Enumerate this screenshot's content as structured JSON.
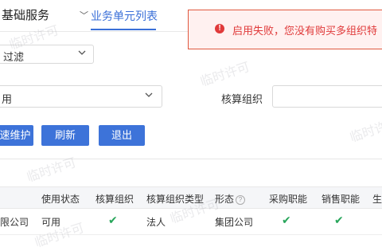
{
  "header": {
    "app_title": "基础服务",
    "active_tab": "业务单元列表"
  },
  "toast": {
    "type": "error",
    "message": "启用失败，您没有购买多组织特"
  },
  "filter": {
    "value": "过滤"
  },
  "search": {
    "status_value": "用",
    "org_label": "核算组织",
    "org_value": ""
  },
  "toolbar": {
    "quick_label": "速维护",
    "refresh_label": "刷新",
    "exit_label": "退出"
  },
  "table": {
    "columns": [
      "使用状态",
      "核算组织",
      "核算组织类型",
      "形态",
      "采购职能",
      "销售职能",
      "生"
    ],
    "rows": [
      {
        "name": "限公司",
        "status": "可用",
        "accounting_org": true,
        "org_type": "法人",
        "form": "集团公司",
        "purchase": true,
        "sales": true
      }
    ]
  },
  "watermark": "临时许可",
  "colors": {
    "accent": "#3a6fd8",
    "button": "#3d73d9",
    "error": "#e03a3a",
    "check": "#27a55a"
  }
}
